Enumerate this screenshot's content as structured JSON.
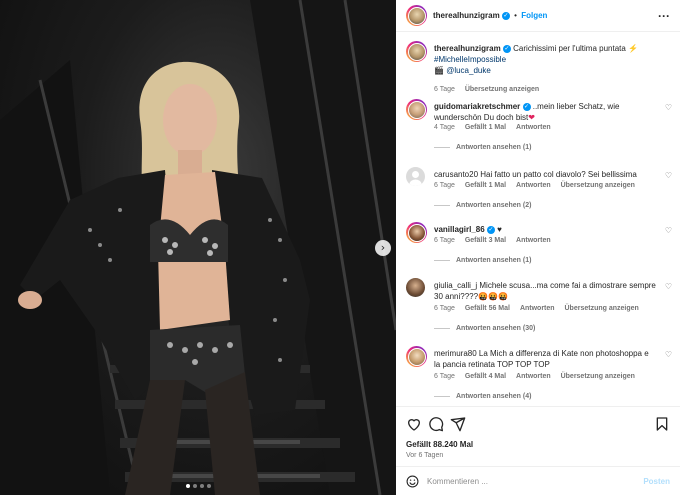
{
  "post": {
    "author": "therealhunzigram",
    "follow_label": "Folgen",
    "separator": "•",
    "more_label": "···"
  },
  "caption": {
    "author": "therealhunzigram",
    "text": "Carichissimi per l'ultima puntata ⚡",
    "hashtag": "#MichelleImpossible",
    "clapper": "🎬",
    "mention": "@luca_duke",
    "age": "6 Tage",
    "translate": "Übersetzung anzeigen"
  },
  "comments": [
    {
      "user": "guidomariakretschmer",
      "verified": true,
      "text": "..mein lieber Schatz, wie wunderschön Du doch bist",
      "emoji": "❤",
      "age": "4 Tage",
      "likes": "Gefällt 1 Mal",
      "reply": "Antworten",
      "replies": "Antworten ansehen (1)"
    },
    {
      "user": "carusanto20",
      "verified": false,
      "text": "Hai fatto un patto col diavolo? Sei bellissima",
      "age": "6 Tage",
      "likes": "Gefällt 1 Mal",
      "reply": "Antworten",
      "translate": "Übersetzung anzeigen",
      "replies": "Antworten ansehen (2)"
    },
    {
      "user": "vanillagirl_86",
      "verified": true,
      "text": "♥",
      "age": "6 Tage",
      "likes": "Gefällt 3 Mal",
      "reply": "Antworten",
      "replies": "Antworten ansehen (1)"
    },
    {
      "user": "giulia_calli_j",
      "verified": false,
      "text": "Michele scusa...ma come fai a dimostrare sempre 30 anni????🤬🤬🤬",
      "age": "6 Tage",
      "likes": "Gefällt 56 Mal",
      "reply": "Antworten",
      "translate": "Übersetzung anzeigen",
      "replies": "Antworten ansehen (30)"
    },
    {
      "user": "merimura80",
      "verified": false,
      "text": "La Mich a differenza di Kate non photoshoppa e la pancia retinata TOP TOP TOP",
      "age": "6 Tage",
      "likes": "Gefällt 4 Mal",
      "reply": "Antworten",
      "translate": "Übersetzung anzeigen",
      "replies": "Antworten ansehen (4)"
    }
  ],
  "footer": {
    "likes": "Gefällt 88.240 Mal",
    "date": "Vor 6 Tagen",
    "comment_placeholder": "Kommentieren ...",
    "post_label": "Posten"
  },
  "icons": {
    "like": "heart-outline-icon",
    "comment": "comment-bubble-icon",
    "share": "paper-plane-icon",
    "save": "bookmark-icon",
    "emoji": "smiley-icon",
    "next": "chevron-right-icon",
    "comment_like": "small-heart-icon"
  },
  "colors": {
    "accent": "#0095f6",
    "link": "#00376b",
    "muted": "#737373",
    "disabled_post": "#b2dffc"
  },
  "carousel": {
    "next_glyph": "›",
    "slides": 4,
    "active_slide": 1
  }
}
